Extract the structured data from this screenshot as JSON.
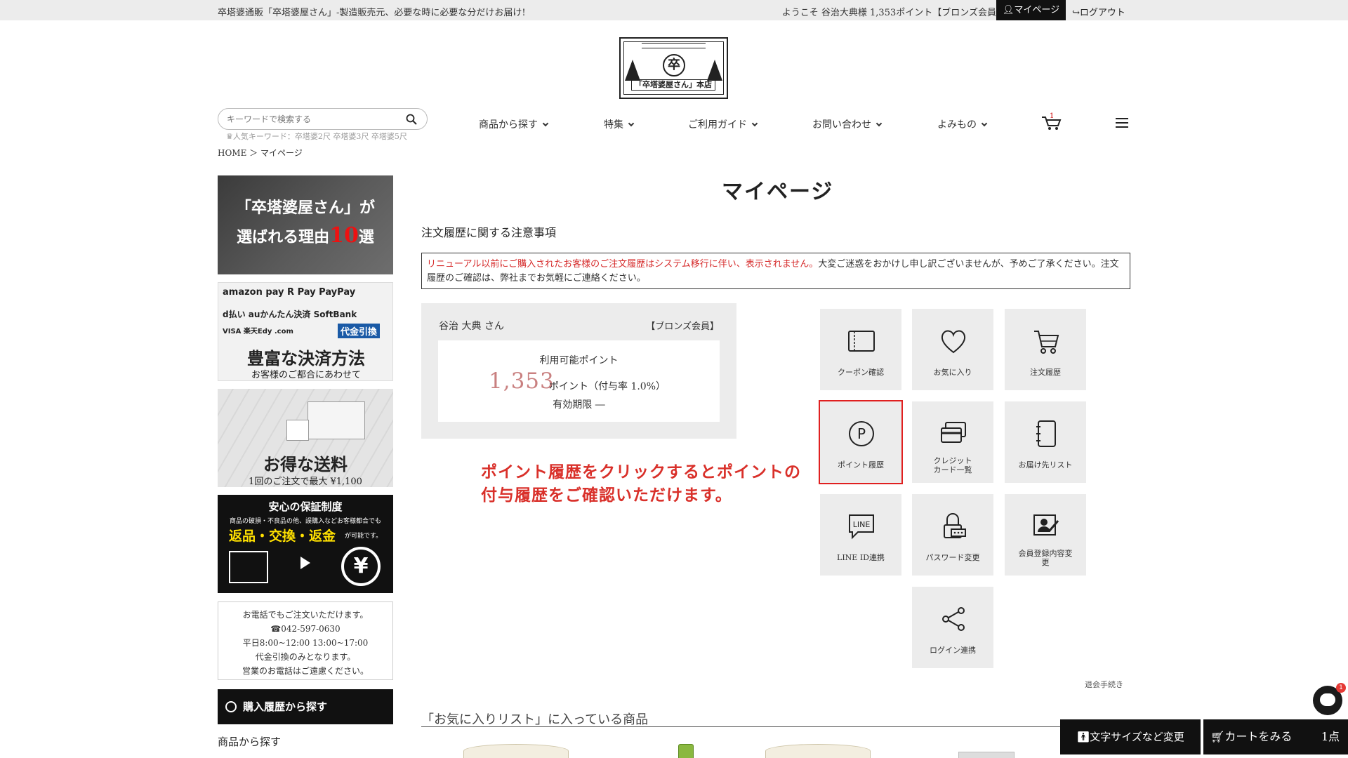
{
  "topbar": {
    "tagline": "卒塔婆通販「卒塔婆屋さん」-製造販売元、必要な時に必要な分だけお届け!",
    "welcome": "ようこそ 谷治大典様 1,353ポイント【ブロンズ会員】",
    "mypage_label": "マイページ",
    "logout_label": "ログアウト"
  },
  "logo": {
    "seal": "卒",
    "name": "「卒塔婆屋さん」本店"
  },
  "search": {
    "placeholder": "キーワードで検索する",
    "popular": "人気キーワード：卒塔婆2尺 卒塔婆3尺 卒塔婆5尺"
  },
  "breadcrumb": "HOME ＞ マイページ",
  "nav": [
    {
      "label": "商品から探す"
    },
    {
      "label": "特集"
    },
    {
      "label": "ご利用ガイド"
    },
    {
      "label": "お問い合わせ"
    },
    {
      "label": "よみもの"
    }
  ],
  "cart_count": "1",
  "sidebar": {
    "banner1": {
      "line1": "「卒塔婆屋さん」が",
      "line2_pre": "選ばれる理由",
      "line2_num": "10",
      "line2_post": "選"
    },
    "banner2": {
      "logos1": "amazon pay  R Pay  PayPay",
      "logos2": "d払い  auかんたん決済  SoftBank",
      "logos3": "VISA  楽天Edy  .com",
      "cod": "代金引換",
      "title": "豊富な決済方法",
      "sub": "お客様のご都合にあわせて"
    },
    "banner3": {
      "title": "お得な送料",
      "sub": "1回のご注文で最大 ¥1,100"
    },
    "banner4": {
      "head": "安心の保証制度",
      "desc": "商品の破損・不良品の他、誤購入などお客様都合でも",
      "yellow": "返品・交換・返金",
      "ok": "が可能です。",
      "yen": "¥"
    },
    "phone": {
      "l1": "お電話でもご注文いただけます。",
      "l2": "042-597-0630",
      "l3": "平日8:00~12:00 13:00~17:00",
      "l4": "代金引換のみとなります。",
      "l5": "営業のお電話はご遠慮ください。"
    },
    "history_btn": "購入履歴から探す",
    "category_heading": "商品から探す"
  },
  "main": {
    "title": "マイページ",
    "notice_title": "注文履歴に関する注意事項",
    "notice_red": "リニューアル以前にご購入されたお客様のご注文履歴はシステム移行に伴い、表示されません。",
    "notice_rest": "大変ご迷惑をおかけし申し訳ございませんが、予めご了承ください。注文履歴のご確認は、弊社までお気軽にご連絡ください。",
    "member": {
      "name": "谷治 大典 さん",
      "rank": "【ブロンズ会員】",
      "label": "利用可能ポイント",
      "points": "1,353",
      "unit": "ポイント（付与率 1.0%）",
      "expiry": "有効期限 ―"
    },
    "annotation_l1": "ポイント履歴をクリックするとポイントの",
    "annotation_l2": "付与履歴をご確認いただけます。",
    "tiles": {
      "coupon": "クーポン確認",
      "favorite": "お気に入り",
      "orders": "注文履歴",
      "points": "ポイント履歴",
      "cards_1": "クレジット",
      "cards_2": "カード一覧",
      "address": "お届け先リスト",
      "line": "LINE ID連携",
      "line_icon_text": "LINE",
      "password": "パスワード変更",
      "profile_1": "会員登録内容変",
      "profile_2": "更",
      "login": "ログイン連携",
      "points_icon_text": "P"
    },
    "withdraw": "退会手続き",
    "favorites_title": "「お気に入りリスト」に入っている商品"
  },
  "floating": {
    "chat_badge": "1",
    "fontsize_btn": "文字サイズなど変更",
    "cart_btn": "カートをみる",
    "cart_qty": "1点"
  }
}
